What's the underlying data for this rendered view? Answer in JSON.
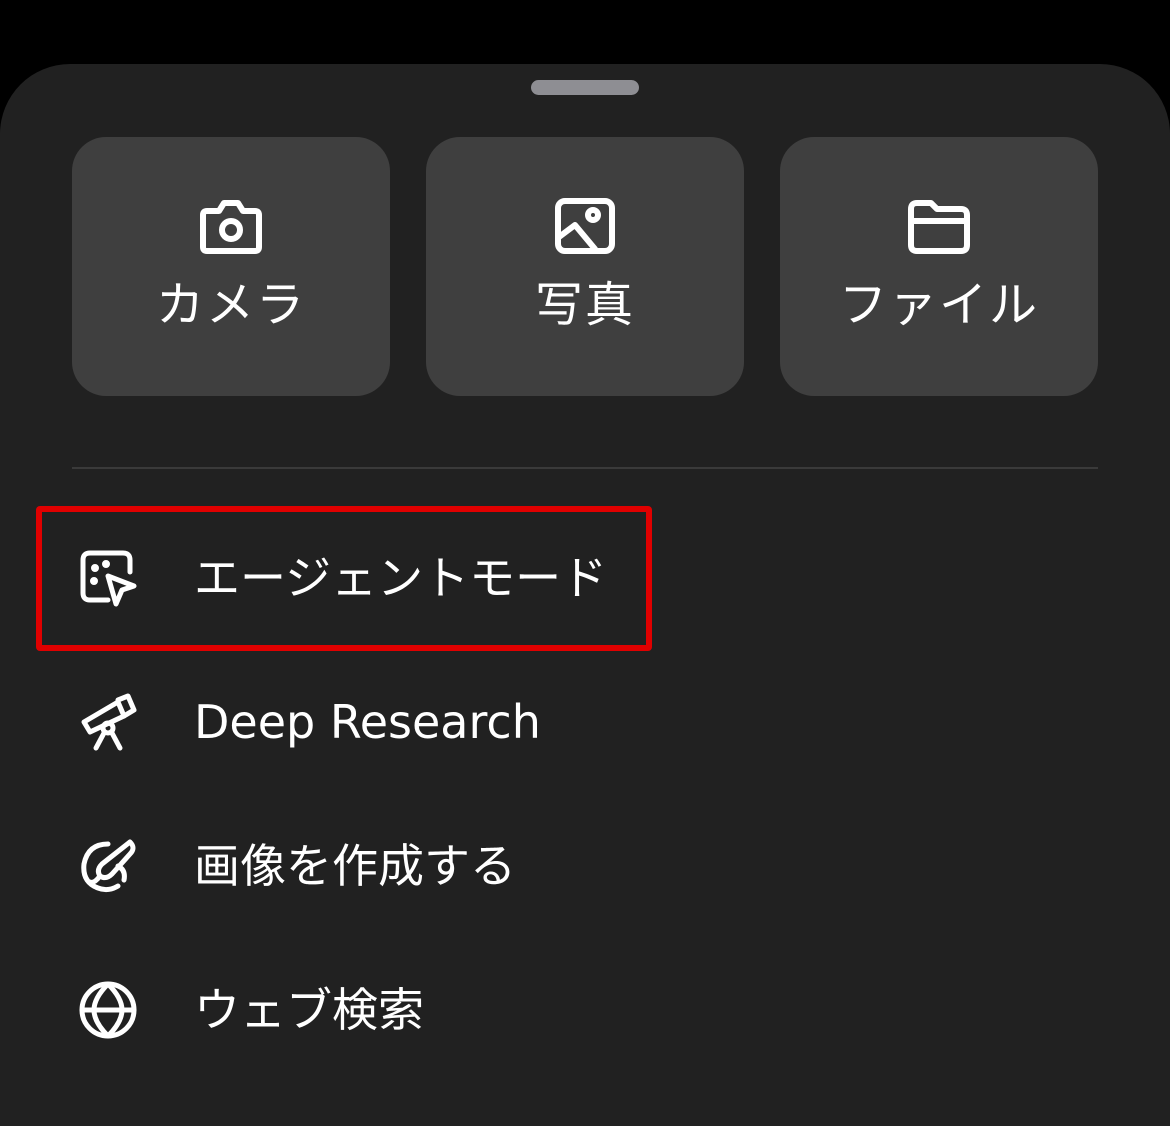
{
  "tiles": [
    {
      "label": "カメラ",
      "icon": "camera-icon"
    },
    {
      "label": "写真",
      "icon": "photo-icon"
    },
    {
      "label": "ファイル",
      "icon": "folder-icon"
    }
  ],
  "menu": [
    {
      "label": "エージェントモード",
      "icon": "agent-cursor-icon"
    },
    {
      "label": "Deep Research",
      "icon": "telescope-icon"
    },
    {
      "label": "画像を作成する",
      "icon": "paint-brush-icon"
    },
    {
      "label": "ウェブ検索",
      "icon": "globe-icon"
    }
  ],
  "colors": {
    "sheet": "#212121",
    "tile": "#3f3f3f",
    "highlight": "#e00000",
    "text": "#ffffff"
  }
}
